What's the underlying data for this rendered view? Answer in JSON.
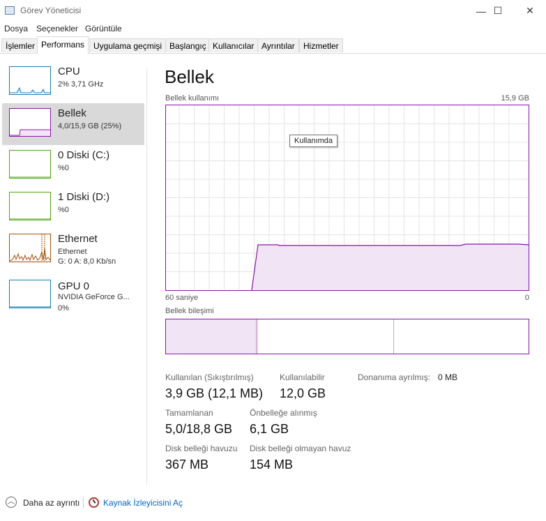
{
  "window": {
    "title": "Görev Yöneticisi",
    "minimize_glyph": "—",
    "maximize_glyph": "☐",
    "close_glyph": "✕"
  },
  "menu": [
    "Dosya",
    "Seçenekler",
    "Görüntüle"
  ],
  "tabs": [
    "İşlemler",
    "Performans",
    "Uygulama geçmişi",
    "Başlangıç",
    "Kullanıcılar",
    "Ayrıntılar",
    "Hizmetler"
  ],
  "active_tab": "Performans",
  "sidebar": {
    "items": [
      {
        "name": "CPU",
        "line1": "2% 3,71 GHz",
        "line2": "",
        "color": "#117dbb",
        "icon": "cpu-graph-icon"
      },
      {
        "name": "Bellek",
        "line1": "4,0/15,9 GB (25%)",
        "line2": "",
        "color": "#8b12ae",
        "icon": "memory-graph-icon"
      },
      {
        "name": "0 Diski (C:)",
        "line1": "%0",
        "line2": "",
        "color": "#4da60c",
        "icon": "disk-graph-icon"
      },
      {
        "name": "1 Diski (D:)",
        "line1": "%0",
        "line2": "",
        "color": "#4da60c",
        "icon": "disk-graph-icon"
      },
      {
        "name": "Ethernet",
        "line1": "Ethernet",
        "line2": "G: 0 A: 8,0 Kb/sn",
        "color": "#a74f01",
        "icon": "ethernet-graph-icon"
      },
      {
        "name": "GPU 0",
        "line1": "NVIDIA GeForce G...",
        "line2": "0%",
        "color": "#117dbb",
        "icon": "gpu-graph-icon"
      }
    ]
  },
  "main": {
    "title": "Bellek",
    "usage_label": "Bellek kullanımı",
    "usage_max": "15,9 GB",
    "time_left": "60 saniye",
    "time_right": "0",
    "tooltip": "Kullanımda",
    "composition_label": "Bellek bileşimi",
    "accent": "#8b12ae",
    "stats": {
      "in_use_label": "Kullanılan (Sıkıştırılmış)",
      "in_use_value": "3,9 GB (12,1 MB)",
      "available_label": "Kullanılabilir",
      "available_value": "12,0 GB",
      "hw_reserved_label": "Donanıma ayrılmış:",
      "hw_reserved_value": "0 MB",
      "committed_label": "Tamamlanan",
      "committed_value": "5,0/18,8 GB",
      "cached_label": "Önbelleğe alınmış",
      "cached_value": "6,1 GB",
      "paged_label": "Disk belleği havuzu",
      "paged_value": "367 MB",
      "nonpaged_label": "Disk belleği olmayan havuz",
      "nonpaged_value": "154 MB"
    }
  },
  "footer": {
    "fewer_details": "Daha az ayrıntı",
    "resource_monitor": "Kaynak İzleyicisini Aç",
    "link_color": "#0066cc"
  }
}
